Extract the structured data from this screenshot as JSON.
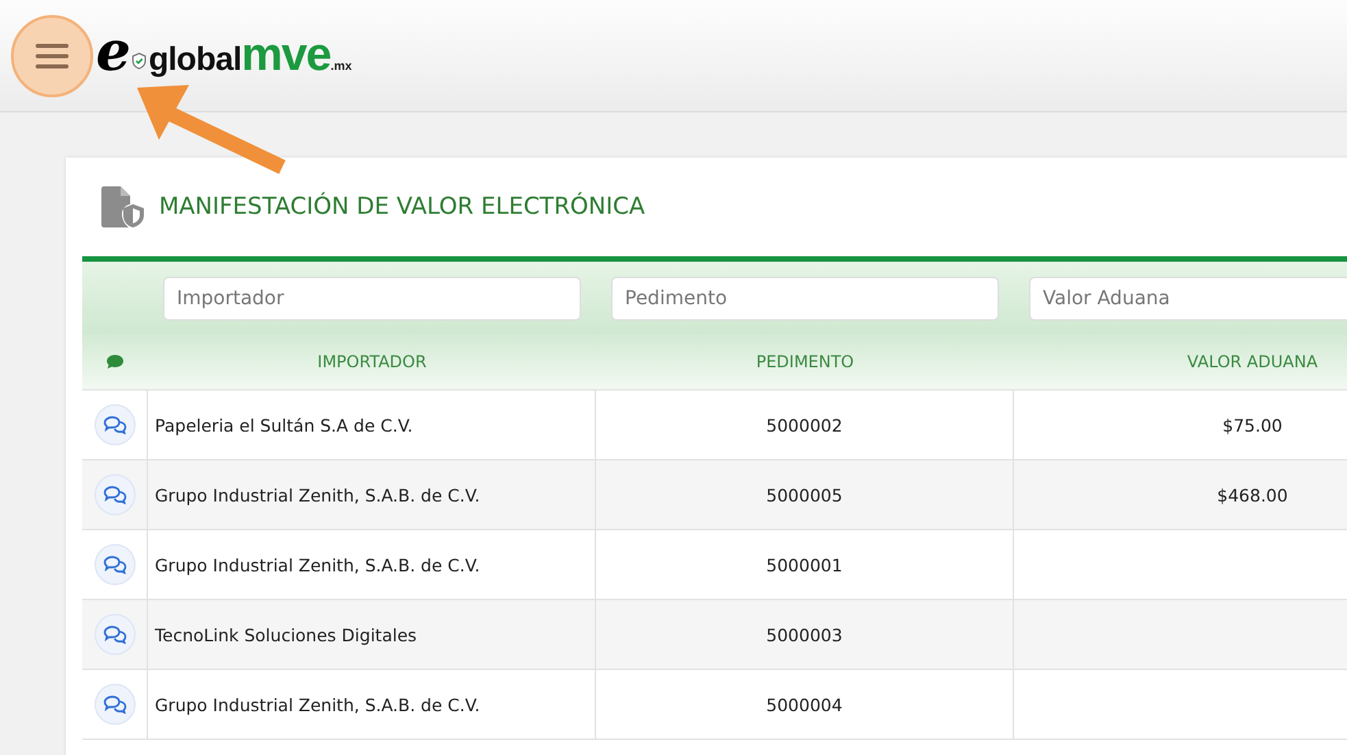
{
  "header": {
    "logo": {
      "letter": "e",
      "word": "global",
      "brand": "mve",
      "suffix": ".mx"
    },
    "menu_button": {
      "highlighted": true
    }
  },
  "card": {
    "title": "MANIFESTACIÓN DE VALOR ELECTRÓNICA",
    "filters": [
      {
        "placeholder": "Importador"
      },
      {
        "placeholder": "Pedimento"
      },
      {
        "placeholder": "Valor Aduana"
      }
    ],
    "columns": [
      "IMPORTADOR",
      "PEDIMENTO",
      "VALOR ADUANA"
    ],
    "rows": [
      {
        "importador": "Papeleria el Sultán S.A de C.V.",
        "pedimento": "5000002",
        "valor_aduana": "$75.00"
      },
      {
        "importador": "Grupo Industrial Zenith, S.A.B. de C.V.",
        "pedimento": "5000005",
        "valor_aduana": "$468.00"
      },
      {
        "importador": "Grupo Industrial Zenith, S.A.B. de C.V.",
        "pedimento": "5000001",
        "valor_aduana": ""
      },
      {
        "importador": "TecnoLink Soluciones Digitales",
        "pedimento": "5000003",
        "valor_aduana": ""
      },
      {
        "importador": "Grupo Industrial Zenith, S.A.B. de C.V.",
        "pedimento": "5000004",
        "valor_aduana": ""
      }
    ]
  }
}
